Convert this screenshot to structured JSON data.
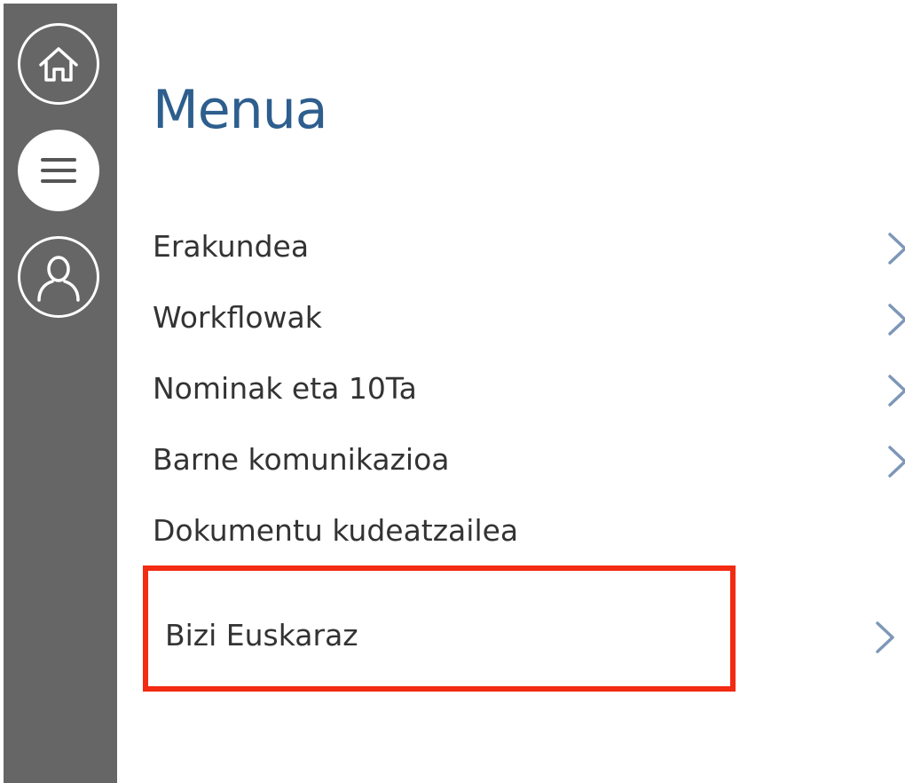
{
  "sidebar": {
    "items": [
      {
        "icon": "home-icon",
        "active": false
      },
      {
        "icon": "hamburger-menu-icon",
        "active": true
      },
      {
        "icon": "user-profile-icon",
        "active": false
      }
    ]
  },
  "main": {
    "title": "Menua",
    "items": [
      {
        "label": "Erakundea",
        "has_chevron": true
      },
      {
        "label": "Workflowak",
        "has_chevron": true
      },
      {
        "label": "Nominak eta 10Ta",
        "has_chevron": true
      },
      {
        "label": "Barne komunikazioa",
        "has_chevron": true
      },
      {
        "label": "Dokumentu kudeatzailea",
        "has_chevron": false
      },
      {
        "label": "Bizi Euskaraz",
        "has_chevron": true,
        "highlighted": true
      }
    ]
  },
  "colors": {
    "sidebar_bg": "#666666",
    "title": "#2d5e8e",
    "item_text": "#333333",
    "chevron": "#7e97b8",
    "highlight_border": "#f22b12"
  }
}
